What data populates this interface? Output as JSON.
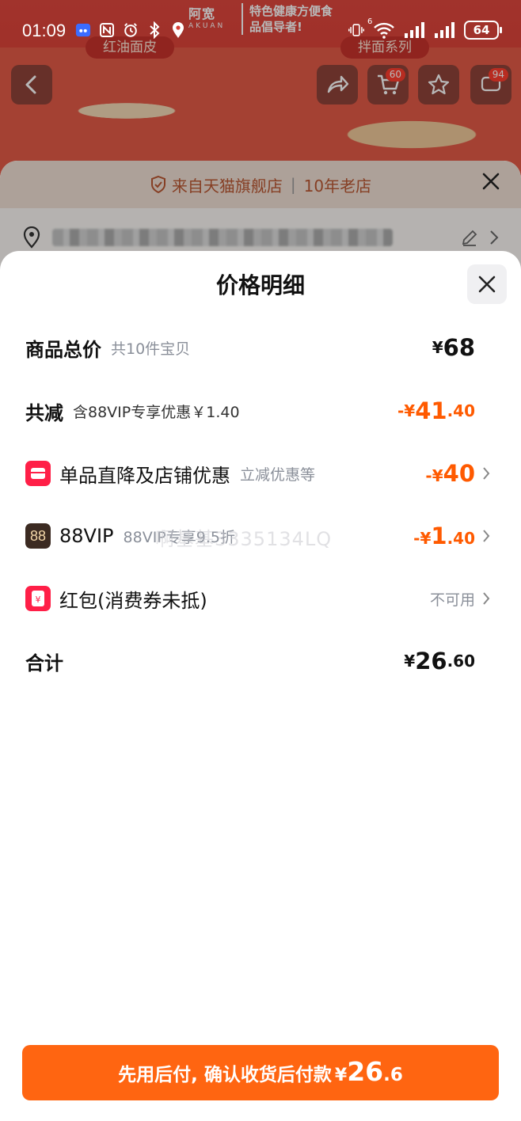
{
  "status_bar": {
    "time": "01:09",
    "network_badge": "6",
    "battery": "64",
    "icons": [
      "app-notify-icon",
      "nfc-icon",
      "alarm-icon",
      "bluetooth-icon",
      "location-icon",
      "vibrate-icon",
      "wifi-icon",
      "signal-icon",
      "signal-icon-2",
      "battery-icon"
    ]
  },
  "background_page": {
    "brand": "阿宽",
    "brand_sub": "AKUAN",
    "slogan": "特色健康方便食品倡导者!",
    "tag_left": "红油面皮",
    "tag_right": "拌面系列",
    "cart_badge": "60",
    "message_badge": "94"
  },
  "store_sheet": {
    "source_text": "来自天猫旗舰店",
    "age_text": "10年老店"
  },
  "price_detail": {
    "title": "价格明细",
    "total": {
      "label": "商品总价",
      "sub": "共10件宝贝",
      "currency": "¥",
      "amount": "68"
    },
    "discount": {
      "label": "共减",
      "sub": "含88VIP专享优惠￥1.40",
      "prefix": "-¥",
      "int": "41",
      "dec": ".40"
    },
    "store_promo": {
      "label": "单品直降及店铺优惠",
      "sub": "立减优惠等",
      "prefix": "-¥",
      "int": "40"
    },
    "vip": {
      "icon_text": "88",
      "label": "88VIP",
      "sub": "88VIP专享9.5折",
      "prefix": "-¥",
      "int": "1",
      "dec": ".40"
    },
    "red_packet": {
      "label": "红包(消费券未抵)",
      "status": "不可用"
    },
    "sum": {
      "label": "合计",
      "currency": "¥",
      "int": "26",
      "dec": ".60"
    },
    "watermark": "啊基基3335134LQ"
  },
  "pay_button": {
    "text": "先用后付, 确认收货后付款",
    "currency": "¥",
    "int": "26",
    "dec": ".6"
  },
  "colors": {
    "accent_orange": "#ff5a00",
    "button_orange": "#ff6511",
    "icon_red": "#ff1f47",
    "store_text": "#b55531"
  }
}
